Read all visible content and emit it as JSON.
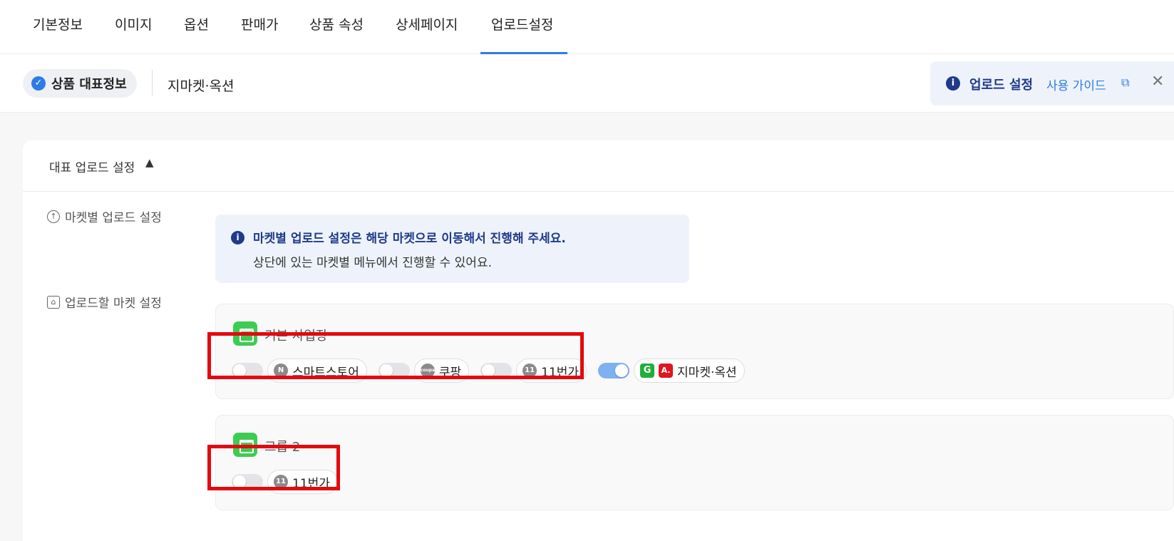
{
  "top_tabs": [
    "기본정보",
    "이미지",
    "옵션",
    "판매가",
    "상품 속성",
    "상세페이지",
    "업로드설정"
  ],
  "active_tab": "업로드설정",
  "subheader": {
    "pill_label": "상품 대표정보",
    "second_tab": "지마켓·옥션",
    "guide": {
      "title": "업로드 설정",
      "link": "사용 가이드",
      "close_icon": "close-icon",
      "external_icon": "external-link-icon"
    }
  },
  "card": {
    "title": "대표 업로드 설정",
    "collapse_glyph": "▲",
    "market_upload_label": "마켓별 업로드 설정",
    "info_line1": "마켓별 업로드 설정은 해당 마켓으로 이동해서 진행해 주세요.",
    "info_line2": "상단에 있는 마켓별 메뉴에서 진행할 수 있어요.",
    "upload_market_label": "업로드할 마켓 설정"
  },
  "groups": [
    {
      "name": "기본 사업장",
      "markets": [
        {
          "name": "스마트스토어",
          "enabled": false,
          "icon": "N"
        },
        {
          "name": "쿠팡",
          "enabled": false,
          "icon": "coupang"
        },
        {
          "name": "11번가",
          "enabled": false,
          "icon": "11"
        },
        {
          "name": "지마켓·옥션",
          "enabled": true,
          "icon": "G A."
        }
      ]
    },
    {
      "name": "그룹 2",
      "markets": [
        {
          "name": "11번가",
          "enabled": false,
          "icon": "11"
        }
      ]
    }
  ],
  "colors": {
    "accent": "#2d7be5",
    "info_text": "#1f3a8a",
    "highlight": "#e5080f",
    "group_icon": "#3dcc52"
  }
}
